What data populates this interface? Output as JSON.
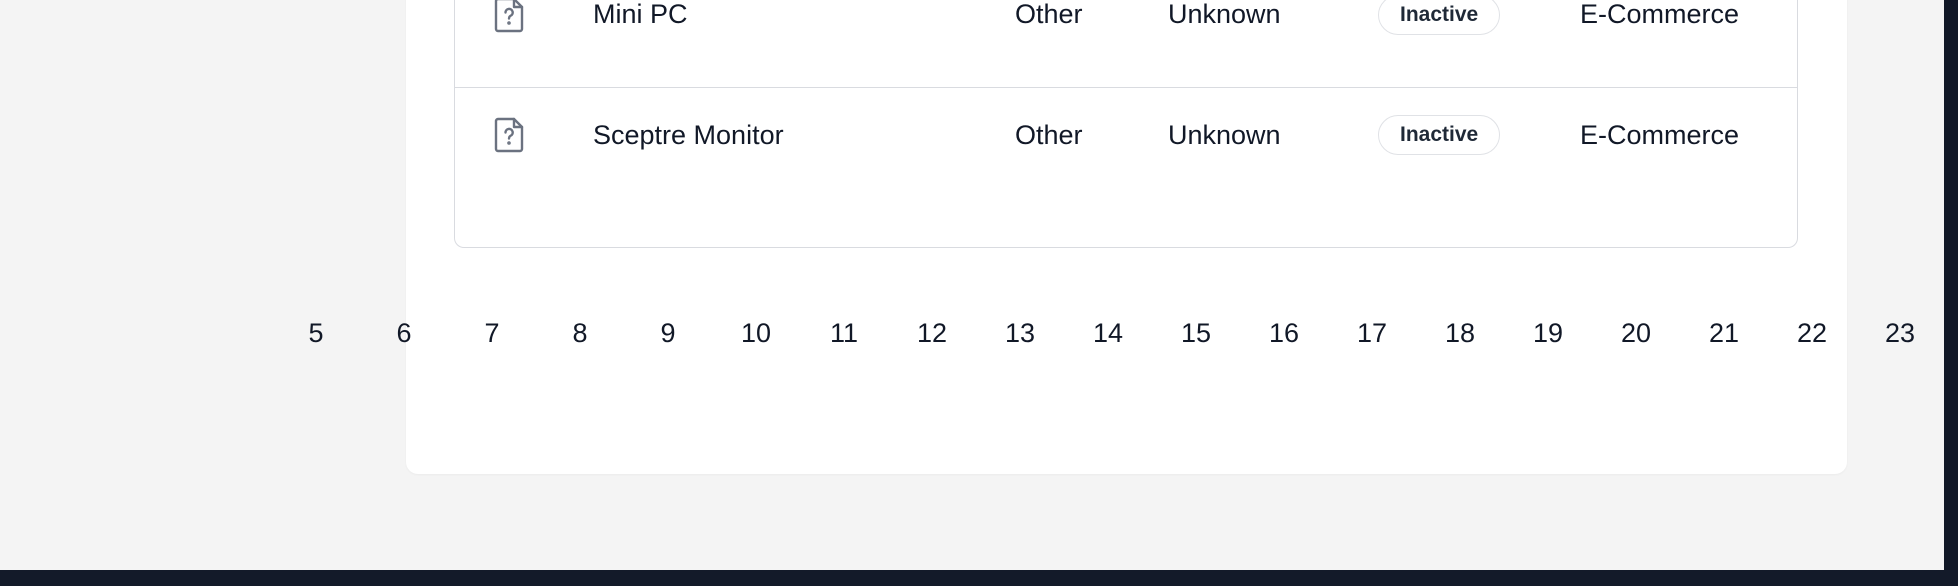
{
  "table": {
    "rows": [
      {
        "name": "Mini PC",
        "type": "Other",
        "status": "Unknown",
        "badge": "Inactive",
        "category": "E-Commerce",
        "icon": "file-question-icon"
      },
      {
        "name": "Sceptre Monitor",
        "type": "Other",
        "status": "Unknown",
        "badge": "Inactive",
        "category": "E-Commerce",
        "icon": "file-question-icon"
      }
    ]
  },
  "pagination": {
    "pages": [
      "5",
      "6",
      "7",
      "8",
      "9",
      "10",
      "11",
      "12",
      "13",
      "14",
      "15",
      "16",
      "17",
      "18",
      "19",
      "20",
      "21",
      "22",
      "23"
    ]
  },
  "colors": {
    "page_background": "#f4f4f4",
    "card_background": "#ffffff",
    "border": "#d9dbe0",
    "dark_bar": "#131a29",
    "icon_stroke": "#6b7280"
  }
}
